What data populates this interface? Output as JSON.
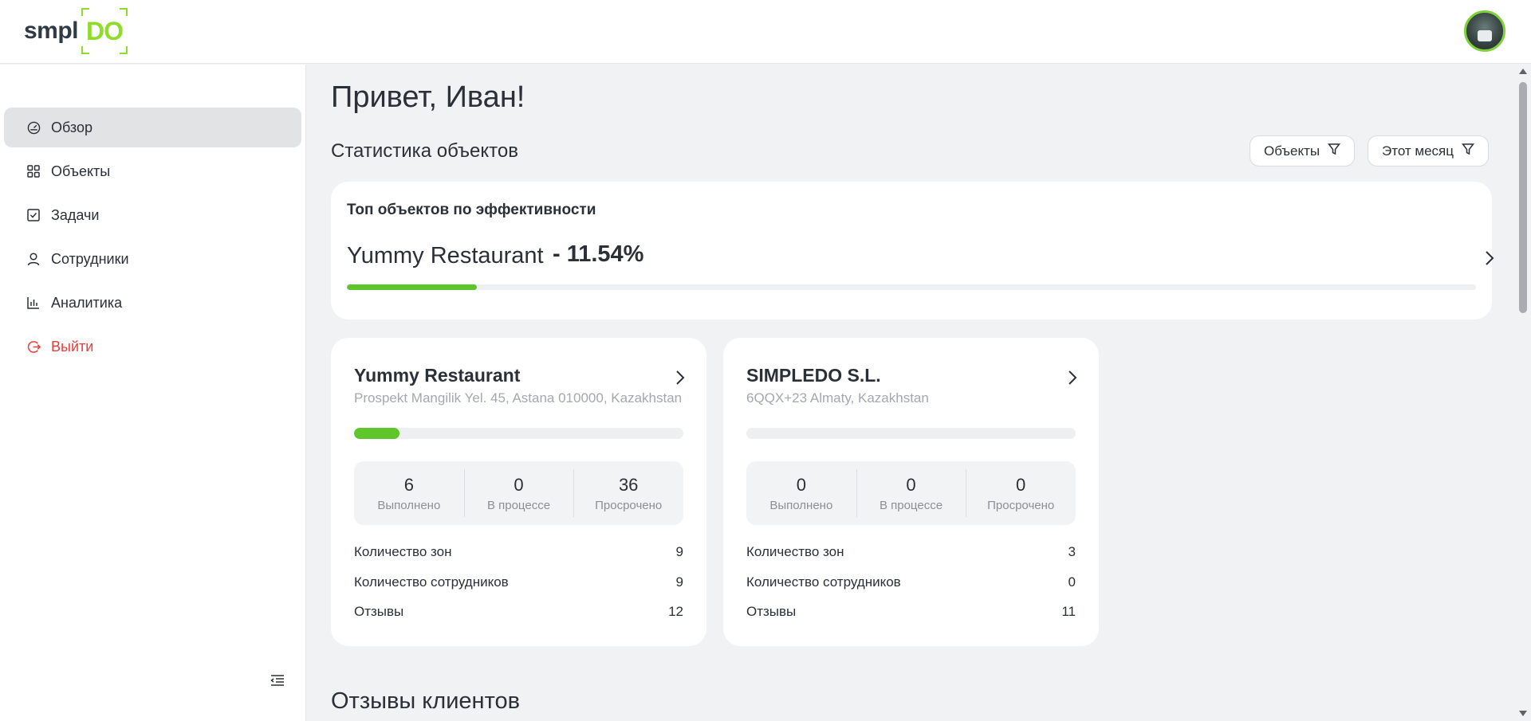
{
  "app": {
    "logo_text_main": "smpl",
    "logo_text_accent": "DO",
    "accent_color": "#8fdc2a",
    "progress_color": "#5ec52a",
    "logout_color": "#ef3b3b"
  },
  "sidebar": {
    "items": [
      {
        "label": "Обзор",
        "icon": "dashboard-icon",
        "active": true
      },
      {
        "label": "Объекты",
        "icon": "grid-icon"
      },
      {
        "label": "Задачи",
        "icon": "checkbox-icon"
      },
      {
        "label": "Сотрудники",
        "icon": "user-icon"
      },
      {
        "label": "Аналитика",
        "icon": "bar-chart-icon"
      },
      {
        "label": "Выйти",
        "icon": "logout-icon"
      }
    ]
  },
  "main": {
    "greeting": "Привет, Иван!",
    "stats_title": "Статистика объектов",
    "filters": {
      "objects": "Объекты",
      "period": "Этот месяц"
    },
    "top_card": {
      "label": "Топ объектов по эффективности",
      "name": "Yummy Restaurant",
      "percent_text": "- 11.54%",
      "progress": 0.1154
    },
    "objects": [
      {
        "title": "Yummy Restaurant",
        "address": "Prospekt Mangilik Yel. 45, Astana 010000, Kazakhstan",
        "progress": 0.1389,
        "stats": [
          {
            "value": "6",
            "label": "Выполнено"
          },
          {
            "value": "0",
            "label": "В процессе"
          },
          {
            "value": "36",
            "label": "Просрочено"
          }
        ],
        "info": [
          {
            "label": "Количество зон",
            "value": "9"
          },
          {
            "label": "Количество сотрудников",
            "value": "9"
          },
          {
            "label": "Отзывы",
            "value": "12"
          }
        ]
      },
      {
        "title": "SIMPLEDO S.L.",
        "address": "6QQX+23 Almaty, Kazakhstan",
        "progress": 0,
        "stats": [
          {
            "value": "0",
            "label": "Выполнено"
          },
          {
            "value": "0",
            "label": "В процессе"
          },
          {
            "value": "0",
            "label": "Просрочено"
          }
        ],
        "info": [
          {
            "label": "Количество зон",
            "value": "3"
          },
          {
            "label": "Количество сотрудников",
            "value": "0"
          },
          {
            "label": "Отзывы",
            "value": "11"
          }
        ]
      }
    ],
    "reviews_title": "Отзывы клиентов"
  }
}
